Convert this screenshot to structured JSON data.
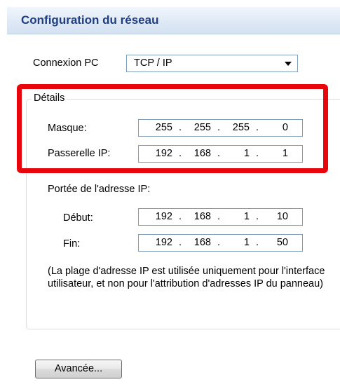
{
  "header": {
    "title": "Configuration du réseau"
  },
  "connection": {
    "label": "Connexion PC",
    "selected": "TCP / IP"
  },
  "details": {
    "legend": "Détails",
    "mask": {
      "label": "Masque:",
      "octets": [
        "255",
        "255",
        "255",
        "0"
      ]
    },
    "gateway": {
      "label": "Passerelle IP:",
      "octets": [
        "192",
        "168",
        "1",
        "1"
      ]
    },
    "range": {
      "label": "Portée de l'adresse IP:",
      "start": {
        "label": "Début:",
        "octets": [
          "192",
          "168",
          "1",
          "10"
        ]
      },
      "end": {
        "label": "Fin:",
        "octets": [
          "192",
          "168",
          "1",
          "50"
        ]
      },
      "note": "(La plage d'adresse IP est utilisée uniquement pour l'interface utilisateur, et non pour l'attribution d'adresses IP du panneau)"
    }
  },
  "octet_separator": ".",
  "buttons": {
    "advanced": "Avancée..."
  },
  "colors": {
    "title": "#1f3f82",
    "highlight": "#e8050b",
    "field_border": "#7f9db9"
  }
}
